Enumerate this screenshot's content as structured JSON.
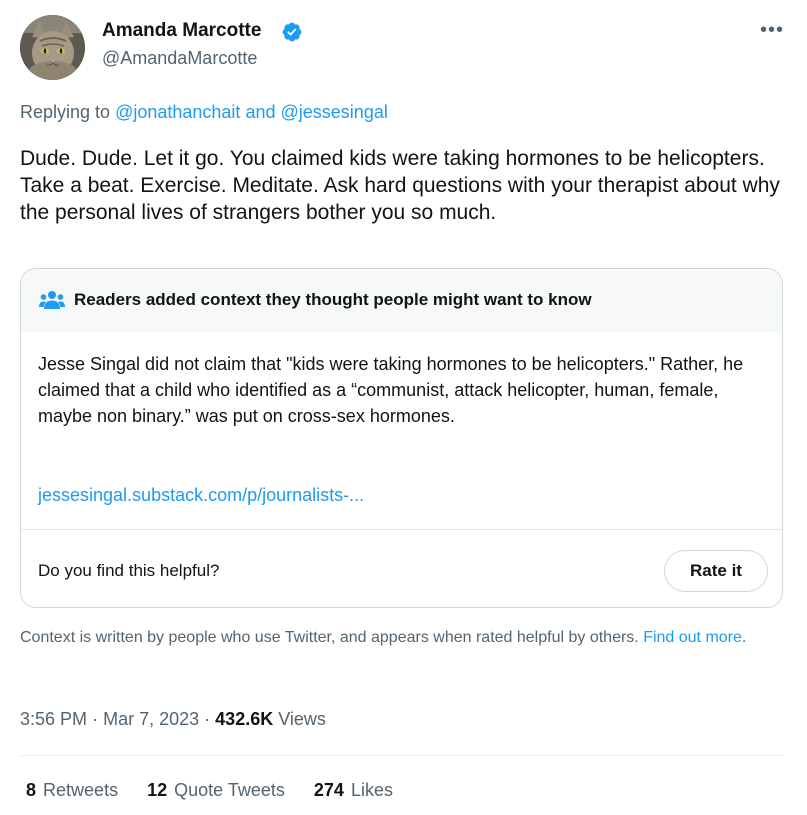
{
  "author": {
    "display_name": "Amanda Marcotte",
    "handle": "@AmandaMarcotte",
    "verified": true
  },
  "reply_context": {
    "prefix": "Replying to",
    "mentions": [
      "@jonathanchait",
      "@jessesingal"
    ],
    "conjunction": "and"
  },
  "tweet_text": "Dude. Dude. Let it go. You claimed kids were taking hormones to be helicopters. Take a beat. Exercise. Meditate. Ask hard questions with your therapist about why the personal lives of strangers bother you so much.",
  "community_note": {
    "header": "Readers added context they thought people might want to know",
    "body": "Jesse Singal did not claim that \"kids were taking hormones to be helicopters.\" Rather, he claimed that a child who identified as a “communist, attack helicopter, human, female, maybe non binary.” was put on cross-sex hormones.",
    "link": "jessesingal.substack.com/p/journalists-...",
    "helpful_question": "Do you find this helpful?",
    "rate_label": "Rate it"
  },
  "context_info": {
    "text": "Context is written by people who use Twitter, and appears when rated helpful by others.",
    "link": "Find out more",
    "end": "."
  },
  "meta": {
    "time": "3:56 PM",
    "date": "Mar 7, 2023",
    "views_count": "432.6K",
    "views_label": "Views"
  },
  "stats": [
    {
      "count": "8",
      "label": "Retweets"
    },
    {
      "count": "12",
      "label": "Quote Tweets"
    },
    {
      "count": "274",
      "label": "Likes"
    }
  ],
  "more_icon": "•••",
  "colors": {
    "accent": "#1d9bf0",
    "secondary_text": "#536471",
    "primary_text": "#0f1419",
    "note_header_bg": "#f7f9f9"
  },
  "icons": {
    "verified": "verified-badge-icon",
    "more": "more-horizontal-icon",
    "people": "people-icon"
  }
}
